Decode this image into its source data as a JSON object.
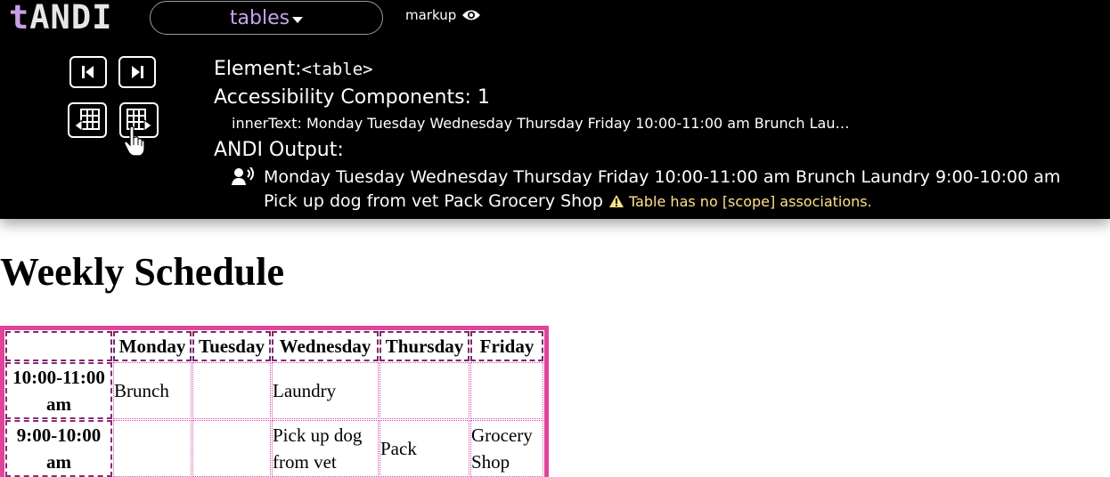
{
  "andi": {
    "logo_prefix": "t",
    "logo_name": "ANDI",
    "module_label": "tables",
    "markup_label": "markup",
    "element_label": "Element:",
    "element_tag": "<table>",
    "accessibility_components_label": "Accessibility Components: 1",
    "inner_text_label": "innerText:",
    "inner_text_value": "Monday Tuesday Wednesday Thursday Friday 10:00-11:00 am Brunch Lau…",
    "output_label": "ANDI Output:",
    "output_text": "Monday Tuesday Wednesday Thursday Friday 10:00-11:00 am Brunch Laundry 9:00-10:00 am Pick up dog from vet Pack Grocery Shop",
    "alert_text": "Table has no [scope] associations.",
    "icons": {
      "prev": "previous-element-icon",
      "next": "next-element-icon",
      "prev_table": "previous-table-icon",
      "next_table": "next-table-icon",
      "markup": "eye-icon",
      "speaker": "speaker-icon",
      "alert": "warning-icon",
      "cursor": "hand-pointer-icon"
    },
    "colors": {
      "bar_bg": "#000000",
      "logo_accent": "#c6a0e6",
      "module_text": "#c8a2f0",
      "alert": "#ffe08a",
      "highlight_border": "#e0449a"
    }
  },
  "page": {
    "title": "Weekly Schedule",
    "table": {
      "headers": [
        "",
        "Monday",
        "Tuesday",
        "Wednesday",
        "Thursday",
        "Friday"
      ],
      "rows": [
        {
          "head": "10:00-11:00 am",
          "cells": [
            "Brunch",
            "",
            "Laundry",
            "",
            ""
          ]
        },
        {
          "head": "9:00-10:00 am",
          "cells": [
            "",
            "",
            "Pick up dog from vet",
            "Pack",
            "Grocery Shop"
          ]
        }
      ]
    }
  }
}
